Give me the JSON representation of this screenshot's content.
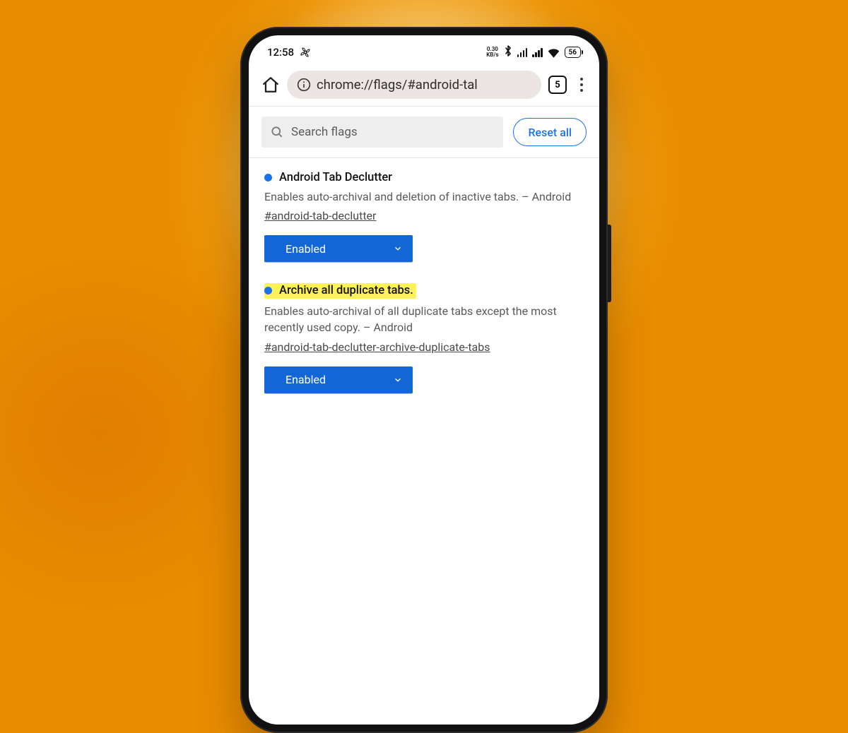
{
  "status": {
    "time": "12:58",
    "net_rate_value": "0.30",
    "net_rate_unit": "KB/s",
    "battery": "56"
  },
  "toolbar": {
    "url": "chrome://flags/#android-tal",
    "tab_count": "5"
  },
  "search": {
    "placeholder": "Search flags"
  },
  "actions": {
    "reset_label": "Reset all"
  },
  "flags": [
    {
      "title": "Android Tab Declutter",
      "description": "Enables auto-archival and deletion of inactive tabs. – Android",
      "hash": "#android-tab-declutter",
      "value": "Enabled",
      "highlighted": false
    },
    {
      "title": "Archive all duplicate tabs.",
      "description": "Enables auto-archival of all duplicate tabs except the most recently used copy. – Android",
      "hash": "#android-tab-declutter-archive-duplicate-tabs",
      "value": "Enabled",
      "highlighted": true
    }
  ]
}
